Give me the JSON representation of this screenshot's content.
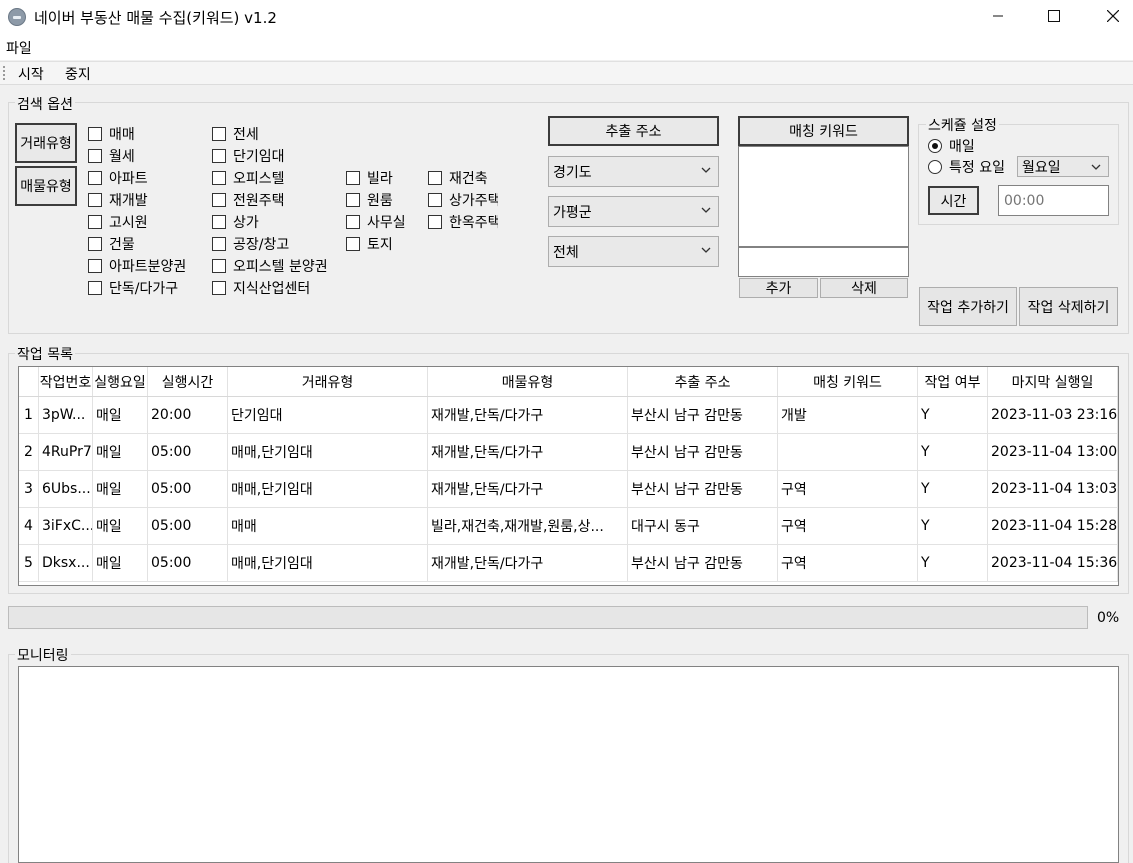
{
  "window": {
    "title": "네이버 부동산 매물 수집(키워드) v1.2",
    "minimize_glyph": "—",
    "maximize_glyph": "☐",
    "close_glyph": "✕"
  },
  "menu": {
    "file": "파일"
  },
  "toolbar": {
    "start": "시작",
    "stop": "중지"
  },
  "search_options": {
    "label": "검색 옵션",
    "trade_type_button": "거래유형",
    "property_type_button": "매물유형",
    "checkboxes": [
      "매매",
      "전세",
      "월세",
      "단기임대",
      "아파트",
      "오피스텔",
      "빌라",
      "재건축",
      "재개발",
      "전원주택",
      "원룸",
      "상가주택",
      "고시원",
      "상가",
      "사무실",
      "한옥주택",
      "건물",
      "공장/창고",
      "토지",
      "아파트분양권",
      "오피스텔 분양권",
      "단독/다가구",
      "지식산업센터"
    ],
    "address_button": "추출 주소",
    "combo_province": "경기도",
    "combo_city": "가평군",
    "combo_district": "전체",
    "keyword_button": "매칭 키워드",
    "keyword_input_value": "",
    "add_button": "추가",
    "delete_button": "삭제"
  },
  "schedule": {
    "label": "스케쥴 설정",
    "radio_daily": "매일",
    "radio_weekday": "특정 요일",
    "weekday_value": "월요일",
    "time_button": "시간",
    "time_placeholder": "00:00",
    "daily_selected": true
  },
  "actions": {
    "add_job": "작업 추가하기",
    "delete_job": "작업 삭제하기"
  },
  "job_list": {
    "label": "작업 목록",
    "columns": [
      "작업번호",
      "실행요일",
      "실행시간",
      "거래유형",
      "매물유형",
      "추출 주소",
      "매칭 키워드",
      "작업 여부",
      "마지막 실행일"
    ],
    "rows": [
      {
        "num": "1",
        "id": "3pW...",
        "day": "매일",
        "time": "20:00",
        "trade": "단기임대",
        "ptype": "재개발,단독/다가구",
        "addr": "부산시 남구 감만동",
        "kw": "개발",
        "status": "Y",
        "last": "2023-11-03 23:16"
      },
      {
        "num": "2",
        "id": "4RuPr7",
        "day": "매일",
        "time": "05:00",
        "trade": "매매,단기임대",
        "ptype": "재개발,단독/다가구",
        "addr": "부산시 남구 감만동",
        "kw": "",
        "status": "Y",
        "last": "2023-11-04 13:00"
      },
      {
        "num": "3",
        "id": "6Ubs...",
        "day": "매일",
        "time": "05:00",
        "trade": "매매,단기임대",
        "ptype": "재개발,단독/다가구",
        "addr": "부산시 남구 감만동",
        "kw": "구역",
        "status": "Y",
        "last": "2023-11-04 13:03"
      },
      {
        "num": "4",
        "id": "3iFxC...",
        "day": "매일",
        "time": "05:00",
        "trade": "매매",
        "ptype": "빌라,재건축,재개발,원룸,상...",
        "addr": "대구시 동구",
        "kw": "구역",
        "status": "Y",
        "last": "2023-11-04 15:28"
      },
      {
        "num": "5",
        "id": "Dksx...",
        "day": "매일",
        "time": "05:00",
        "trade": "매매,단기임대",
        "ptype": "재개발,단독/다가구",
        "addr": "부산시 남구 감만동",
        "kw": "구역",
        "status": "Y",
        "last": "2023-11-04 15:36"
      }
    ]
  },
  "progress": {
    "value": 0,
    "label": "0%",
    "color": "#06b025"
  },
  "monitor": {
    "label": "모니터링",
    "content": ""
  }
}
